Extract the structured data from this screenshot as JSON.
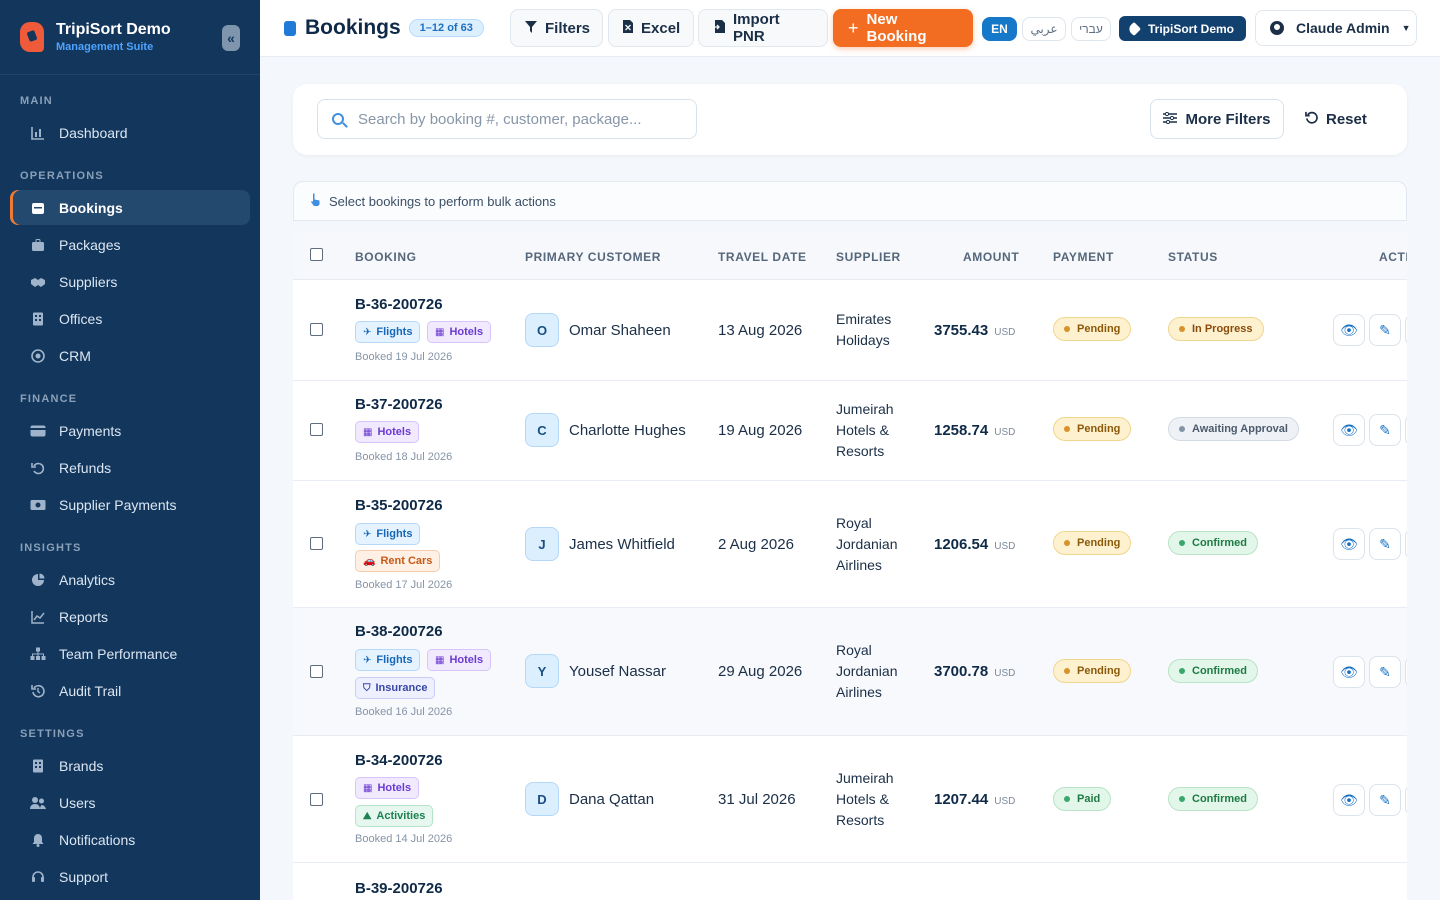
{
  "app": {
    "name": "TripiSort Demo",
    "subtitle": "Management Suite"
  },
  "sidebar": {
    "sections": [
      {
        "title": "MAIN",
        "items": [
          {
            "label": "Dashboard",
            "icon": "dashboard-icon"
          }
        ]
      },
      {
        "title": "OPERATIONS",
        "items": [
          {
            "label": "Bookings",
            "icon": "calendar-icon",
            "active": true
          },
          {
            "label": "Packages",
            "icon": "briefcase-icon"
          },
          {
            "label": "Suppliers",
            "icon": "handshake-icon"
          },
          {
            "label": "Offices",
            "icon": "building-icon"
          },
          {
            "label": "CRM",
            "icon": "target-icon"
          }
        ]
      },
      {
        "title": "FINANCE",
        "items": [
          {
            "label": "Payments",
            "icon": "credit-card-icon"
          },
          {
            "label": "Refunds",
            "icon": "undo-icon"
          },
          {
            "label": "Supplier Payments",
            "icon": "money-icon"
          }
        ]
      },
      {
        "title": "INSIGHTS",
        "items": [
          {
            "label": "Analytics",
            "icon": "pie-chart-icon"
          },
          {
            "label": "Reports",
            "icon": "line-chart-icon"
          },
          {
            "label": "Team Performance",
            "icon": "org-chart-icon"
          },
          {
            "label": "Audit Trail",
            "icon": "history-icon"
          }
        ]
      },
      {
        "title": "SETTINGS",
        "items": [
          {
            "label": "Brands",
            "icon": "building-icon"
          },
          {
            "label": "Users",
            "icon": "users-icon"
          },
          {
            "label": "Notifications",
            "icon": "bell-icon"
          },
          {
            "label": "Support",
            "icon": "headset-icon"
          }
        ]
      }
    ]
  },
  "header": {
    "title": "Bookings",
    "count_badge": "1–12 of 63",
    "filters_label": "Filters",
    "excel_label": "Excel",
    "import_label": "Import PNR",
    "new_booking_label": "New Booking",
    "languages": [
      "EN",
      "عربي",
      "עברי"
    ],
    "active_language": "EN",
    "brand_pill": "TripiSort Demo",
    "user_name": "Claude Admin"
  },
  "search": {
    "placeholder": "Search by booking #, customer, package...",
    "value": "",
    "more_filters_label": "More Filters",
    "reset_label": "Reset"
  },
  "bulk": {
    "text": "Select bookings to perform bulk actions"
  },
  "table": {
    "columns": [
      "BOOKING",
      "PRIMARY CUSTOMER",
      "TRAVEL DATE",
      "SUPPLIER",
      "AMOUNT",
      "PAYMENT",
      "STATUS",
      "ACTI"
    ],
    "currency": "USD",
    "rows": [
      {
        "id": "B-36-200726",
        "services": [
          "Flights",
          "Hotels"
        ],
        "booked": "Booked 19 Jul 2026",
        "initial": "O",
        "customer": "Omar Shaheen",
        "travel_date": "13 Aug 2026",
        "supplier": "Emirates Holidays",
        "amount": "3755.43",
        "payment": "Pending",
        "status": "In Progress"
      },
      {
        "id": "B-37-200726",
        "services": [
          "Hotels"
        ],
        "booked": "Booked 18 Jul 2026",
        "initial": "C",
        "customer": "Charlotte Hughes",
        "travel_date": "19 Aug 2026",
        "supplier": "Jumeirah Hotels & Resorts",
        "amount": "1258.74",
        "payment": "Pending",
        "status": "Awaiting Approval"
      },
      {
        "id": "B-35-200726",
        "services": [
          "Flights",
          "Rent Cars"
        ],
        "booked": "Booked 17 Jul 2026",
        "initial": "J",
        "customer": "James Whitfield",
        "travel_date": "2 Aug 2026",
        "supplier": "Royal Jordanian Airlines",
        "amount": "1206.54",
        "payment": "Pending",
        "status": "Confirmed"
      },
      {
        "id": "B-38-200726",
        "services": [
          "Flights",
          "Hotels",
          "Insurance"
        ],
        "booked": "Booked 16 Jul 2026",
        "initial": "Y",
        "customer": "Yousef Nassar",
        "travel_date": "29 Aug 2026",
        "supplier": "Royal Jordanian Airlines",
        "amount": "3700.78",
        "payment": "Pending",
        "status": "Confirmed"
      },
      {
        "id": "B-34-200726",
        "services": [
          "Hotels",
          "Activities"
        ],
        "booked": "Booked 14 Jul 2026",
        "initial": "D",
        "customer": "Dana Qattan",
        "travel_date": "31 Jul 2026",
        "supplier": "Jumeirah Hotels & Resorts",
        "amount": "1207.44",
        "payment": "Paid",
        "status": "Confirmed"
      },
      {
        "id": "B-39-200726"
      }
    ]
  },
  "colors": {
    "sidebar_bg": "#13365c",
    "accent_orange": "#f26d21",
    "accent_blue": "#1678c8"
  }
}
